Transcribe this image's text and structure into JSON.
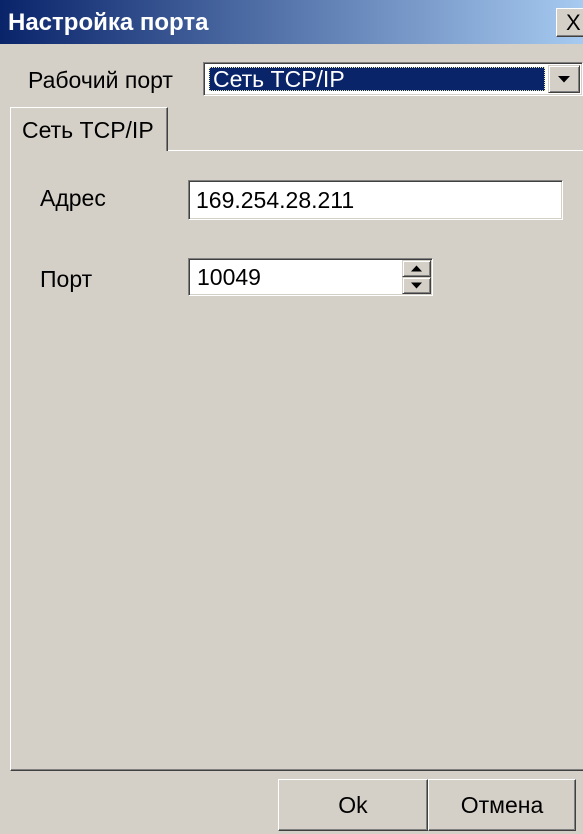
{
  "window": {
    "title": "Настройка порта",
    "close_label": "X"
  },
  "work_port": {
    "label": "Рабочий порт",
    "selected": "Сеть TCP/IP"
  },
  "tabs": [
    {
      "label": "Сеть TCP/IP",
      "active": true
    }
  ],
  "tcp_ip": {
    "address": {
      "label": "Адрес",
      "value": "169.254.28.211"
    },
    "port": {
      "label": "Порт",
      "value": "10049"
    }
  },
  "buttons": {
    "ok": "Ok",
    "cancel": "Отмена"
  },
  "icons": {
    "dropdown": "dropdown-arrow-icon",
    "spin_up": "spin-up-arrow-icon",
    "spin_down": "spin-down-arrow-icon",
    "close": "close-icon"
  },
  "colors": {
    "title_start": "#0a246a",
    "title_end": "#a6caf0",
    "title_text": "#ffffff",
    "face": "#d4d0c8",
    "selection": "#0a246a"
  }
}
